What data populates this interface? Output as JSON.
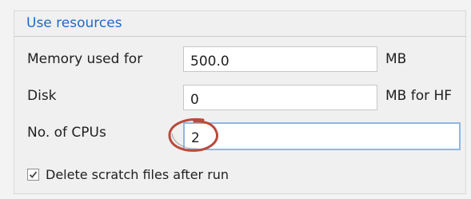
{
  "group": {
    "title": "Use resources"
  },
  "rows": [
    {
      "label": "Memory used for",
      "value": "500.0",
      "unit": "MB"
    },
    {
      "label": "Disk",
      "value": "0",
      "unit": "MB for HF"
    },
    {
      "label": "No. of CPUs",
      "value": "2",
      "unit": ""
    }
  ],
  "checkbox": {
    "label": "Delete scratch files after run",
    "checked": true
  },
  "colors": {
    "title": "#1b6ac9",
    "annotation": "#b94a3c"
  }
}
